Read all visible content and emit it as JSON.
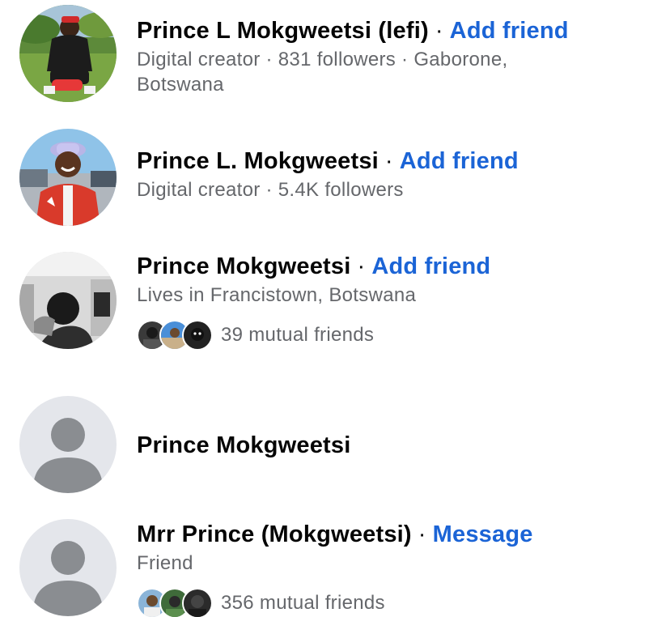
{
  "results": [
    {
      "name": "Prince L Mokgweetsi (lefi)",
      "separator": "·",
      "action": "Add friend",
      "subtitle": "Digital creator · 831 followers · Gaborone, Botswana"
    },
    {
      "name": "Prince L. Mokgweetsi",
      "separator": "·",
      "action": "Add friend",
      "subtitle": "Digital creator · 5.4K followers"
    },
    {
      "name": "Prince Mokgweetsi",
      "separator": "·",
      "action": "Add friend",
      "subtitle": "Lives in Francistown, Botswana",
      "mutual": "39 mutual friends"
    },
    {
      "name": "Prince Mokgweetsi"
    },
    {
      "name": "Mrr Prince (Mokgweetsi)",
      "separator": "·",
      "action": "Message",
      "subtitle": "Friend",
      "mutual": "356 mutual friends"
    }
  ],
  "colors": {
    "action_blue": "#1b64d6",
    "secondary_text": "#65676b",
    "default_avatar_bg": "#e4e6eb",
    "default_avatar_fg": "#8a8d91"
  }
}
